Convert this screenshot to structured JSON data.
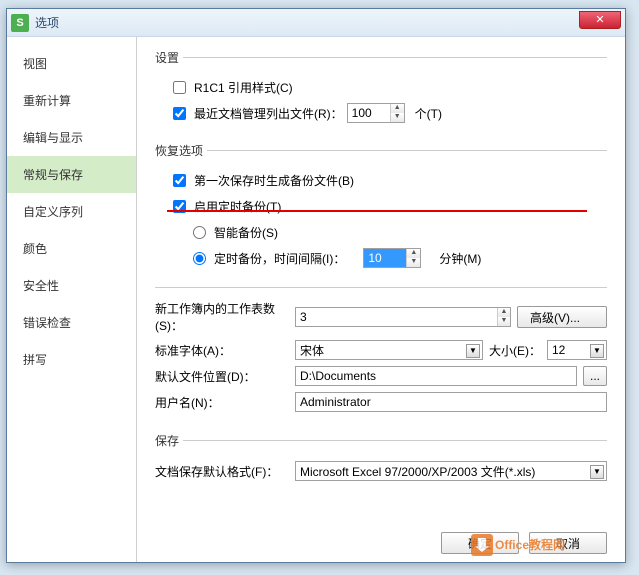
{
  "window": {
    "title": "选项"
  },
  "sidebar": {
    "items": [
      {
        "label": "视图"
      },
      {
        "label": "重新计算"
      },
      {
        "label": "编辑与显示"
      },
      {
        "label": "常规与保存"
      },
      {
        "label": "自定义序列"
      },
      {
        "label": "颜色"
      },
      {
        "label": "安全性"
      },
      {
        "label": "错误检查"
      },
      {
        "label": "拼写"
      }
    ],
    "activeIndex": 3
  },
  "settings": {
    "legend": "设置",
    "r1c1_label": "R1C1 引用样式(C)",
    "recent_label": "最近文档管理列出文件(R)：",
    "recent_value": "100",
    "recent_unit": "个(T)"
  },
  "recovery": {
    "legend": "恢复选项",
    "first_save_label": "第一次保存时生成备份文件(B)",
    "enable_timed_label": "启用定时备份(T)",
    "smart_backup_label": "智能备份(S)",
    "timed_backup_label": "定时备份，时间间隔(I)：",
    "timed_value": "10",
    "timed_unit": "分钟(M)"
  },
  "general": {
    "sheets_label": "新工作簿内的工作表数(S)：",
    "sheets_value": "3",
    "advanced_btn": "高级(V)...",
    "font_label": "标准字体(A)：",
    "font_value": "宋体",
    "size_label": "大小(E)：",
    "size_value": "12",
    "path_label": "默认文件位置(D)：",
    "path_value": "D:\\Documents",
    "browse_btn": "...",
    "user_label": "用户名(N)：",
    "user_value": "Administrator"
  },
  "save": {
    "legend": "保存",
    "format_label": "文档保存默认格式(F)：",
    "format_value": "Microsoft Excel 97/2000/XP/2003 文件(*.xls)"
  },
  "footer": {
    "ok": "确定",
    "cancel": "取消"
  },
  "watermark": "Office教程网"
}
